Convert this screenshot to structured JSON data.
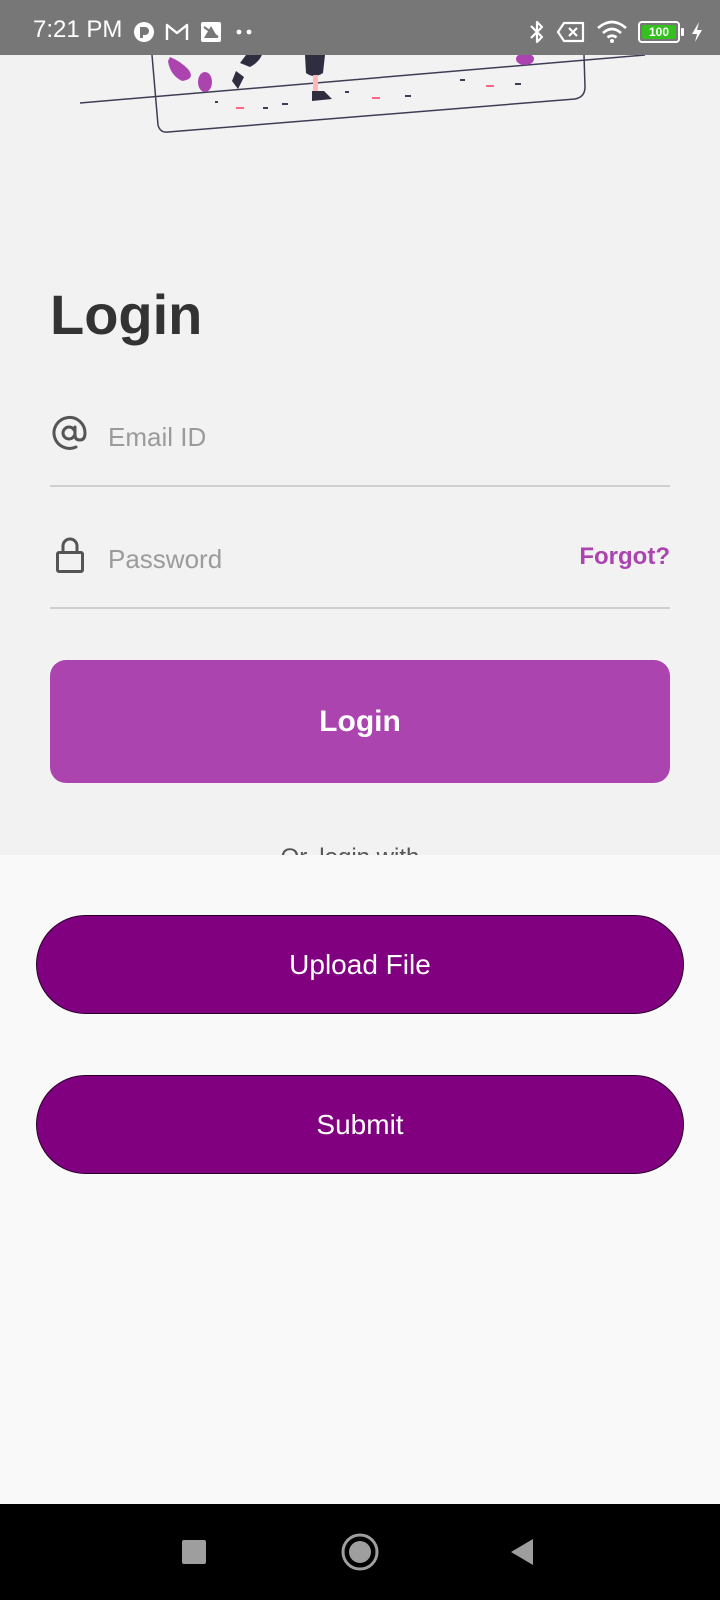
{
  "status_bar": {
    "time": "7:21 PM",
    "battery_level": "100",
    "left_icons": [
      "notification-app-icon",
      "gmail-icon",
      "photos-icon",
      "more-dots-icon"
    ],
    "right_icons": [
      "bluetooth-icon",
      "no-sim-icon",
      "wifi-icon",
      "battery-icon",
      "charging-icon"
    ]
  },
  "login": {
    "title": "Login",
    "email_placeholder": "Email ID",
    "password_placeholder": "Password",
    "forgot_label": "Forgot?",
    "login_button": "Login",
    "or_login_with": "Or, login with..."
  },
  "sheet": {
    "upload_button": "Upload File",
    "submit_button": "Submit"
  },
  "colors": {
    "accent": "#ac44b0",
    "sheet_button": "#800080",
    "status_bar": "#777777"
  },
  "nav_bar": {
    "items": [
      "recents-icon",
      "home-icon",
      "back-icon"
    ]
  }
}
